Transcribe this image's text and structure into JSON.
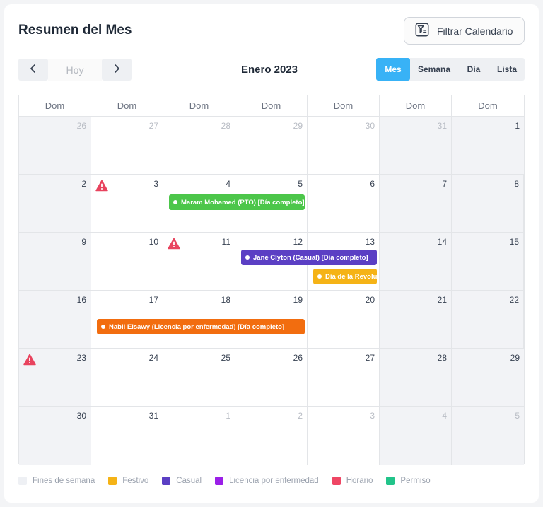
{
  "header": {
    "title": "Resumen del Mes",
    "filter_label": "Filtrar Calendario"
  },
  "toolbar": {
    "prev_icon": "chevron-left-icon",
    "today_label": "Hoy",
    "next_icon": "chevron-right-icon",
    "month_label": "Enero 2023",
    "views": [
      {
        "label": "Mes",
        "active": true
      },
      {
        "label": "Semana",
        "active": false
      },
      {
        "label": "Día",
        "active": false
      },
      {
        "label": "Lista",
        "active": false
      }
    ]
  },
  "calendar": {
    "weekday_headers": [
      "Dom",
      "Dom",
      "Dom",
      "Dom",
      "Dom",
      "Dom",
      "Dom"
    ],
    "weeks": [
      [
        {
          "d": "26",
          "muted": true,
          "weekend": true
        },
        {
          "d": "27",
          "muted": true
        },
        {
          "d": "28",
          "muted": true
        },
        {
          "d": "29",
          "muted": true
        },
        {
          "d": "30",
          "muted": true
        },
        {
          "d": "31",
          "muted": true,
          "weekend": true
        },
        {
          "d": "1",
          "weekend": true
        }
      ],
      [
        {
          "d": "2",
          "weekend": true
        },
        {
          "d": "3",
          "warning": true
        },
        {
          "d": "4"
        },
        {
          "d": "5"
        },
        {
          "d": "6"
        },
        {
          "d": "7",
          "weekend": true
        },
        {
          "d": "8",
          "weekend": true
        }
      ],
      [
        {
          "d": "9",
          "weekend": true
        },
        {
          "d": "10"
        },
        {
          "d": "11",
          "warning": true
        },
        {
          "d": "12"
        },
        {
          "d": "13"
        },
        {
          "d": "14",
          "weekend": true
        },
        {
          "d": "15",
          "weekend": true
        }
      ],
      [
        {
          "d": "16",
          "weekend": true
        },
        {
          "d": "17"
        },
        {
          "d": "18"
        },
        {
          "d": "19"
        },
        {
          "d": "20"
        },
        {
          "d": "21",
          "weekend": true
        },
        {
          "d": "22",
          "weekend": true
        }
      ],
      [
        {
          "d": "23",
          "weekend": true,
          "warning": true
        },
        {
          "d": "24"
        },
        {
          "d": "25"
        },
        {
          "d": "26"
        },
        {
          "d": "27"
        },
        {
          "d": "28",
          "weekend": true
        },
        {
          "d": "29",
          "weekend": true
        }
      ],
      [
        {
          "d": "30",
          "weekend": true
        },
        {
          "d": "31"
        },
        {
          "d": "1",
          "muted": true
        },
        {
          "d": "2",
          "muted": true
        },
        {
          "d": "3",
          "muted": true
        },
        {
          "d": "4",
          "muted": true,
          "weekend": true
        },
        {
          "d": "5",
          "muted": true,
          "weekend": true
        }
      ]
    ],
    "events": [
      {
        "label": "Maram Mohamed  (PTO) [Día completo]",
        "type": "Permiso",
        "color": "#4cc64a",
        "week": 1,
        "start": 2,
        "end": 3
      },
      {
        "label": "Jane Clyton  (Casual) [Día completo]",
        "type": "Casual",
        "color": "#5b3fc4",
        "week": 2,
        "start": 3,
        "end": 4
      },
      {
        "label": "Día de la Revolución",
        "type": "Festivo",
        "color": "#f5b316",
        "week": 2,
        "start": 4,
        "end": 4
      },
      {
        "label": "Nabil Elsawy  (Licencia por enfermedad) [Día completo]",
        "type": "Licencia por enfermedad",
        "color": "#f26d0f",
        "week": 3,
        "start": 1,
        "end": 3
      }
    ]
  },
  "legend": [
    {
      "label": "Fines de semana",
      "color": "#eef0f4"
    },
    {
      "label": "Festivo",
      "color": "#f5b316"
    },
    {
      "label": "Casual",
      "color": "#5b3fc4"
    },
    {
      "label": "Licencia por enfermedad",
      "color": "#9b1fe8"
    },
    {
      "label": "Horario",
      "color": "#ef4664"
    },
    {
      "label": "Permiso",
      "color": "#22c48a"
    }
  ],
  "icons": {
    "warning": "warning-triangle-icon",
    "filter": "filter-calendar-icon"
  },
  "colors": {
    "accent": "#38b2f6",
    "warning": "#e8435e"
  }
}
